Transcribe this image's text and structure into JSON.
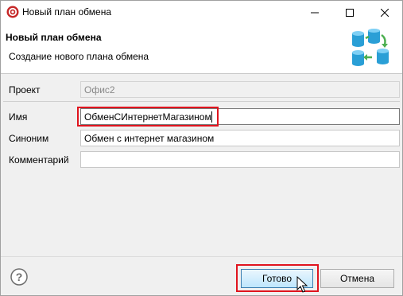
{
  "window": {
    "title": "Новый план обмена",
    "controls": {
      "minimize": "—",
      "maximize": "☐",
      "close": "✕"
    }
  },
  "banner": {
    "title": "Новый план обмена",
    "description": "Создание нового плана обмена",
    "icon": "exchange-plan-icon"
  },
  "form": {
    "project": {
      "label": "Проект",
      "value": "Офис2"
    },
    "name": {
      "label": "Имя",
      "value": "ОбменСИнтернетМагазином"
    },
    "synonym": {
      "label": "Синоним",
      "value": "Обмен с интернет магазином"
    },
    "comment": {
      "label": "Комментарий",
      "value": ""
    }
  },
  "footer": {
    "help_icon": "help-icon",
    "finish_label": "Готово",
    "cancel_label": "Отмена"
  },
  "colors": {
    "highlight": "#e0141e",
    "accent_green": "#4caf50",
    "accent_blue": "#2a9fd6"
  }
}
